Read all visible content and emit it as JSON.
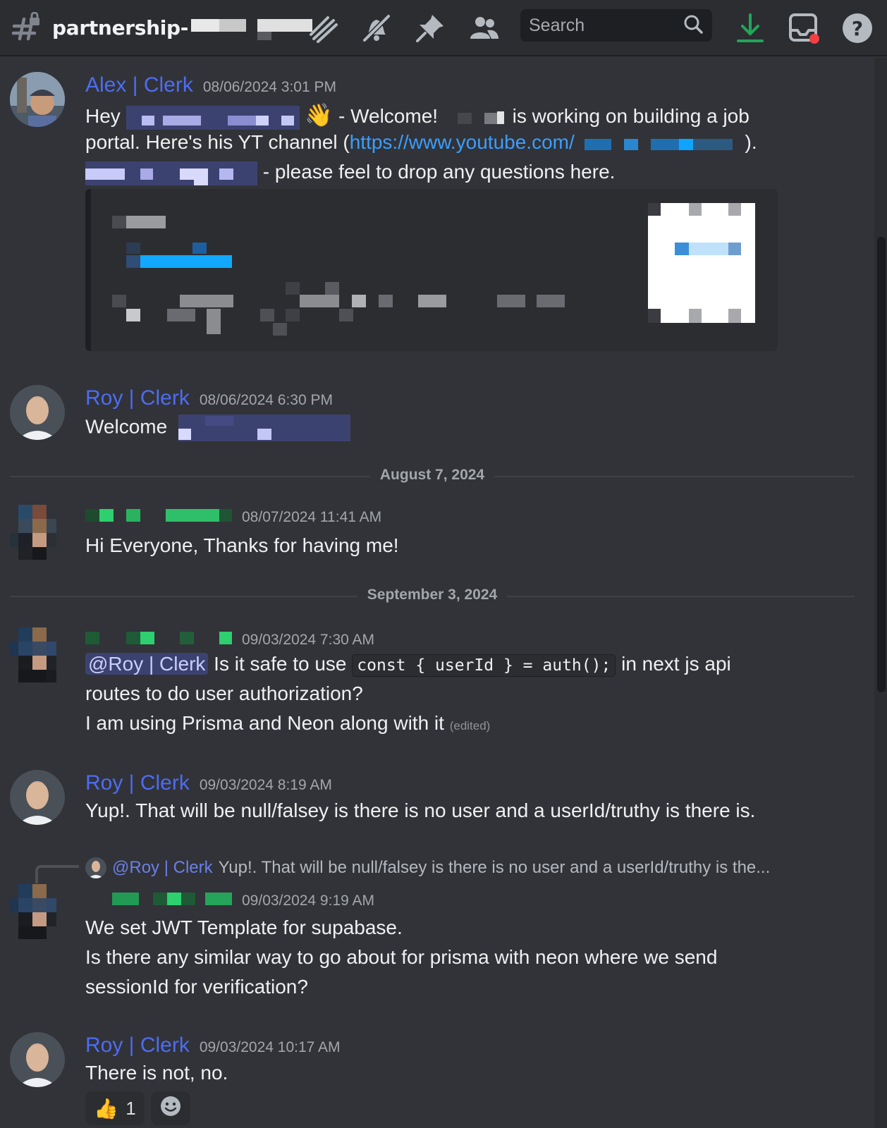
{
  "header": {
    "channel_name": "partnership-",
    "search_placeholder": "Search",
    "icons": [
      "hash-lock-icon",
      "threads-icon",
      "mute-icon",
      "pin-icon",
      "members-icon",
      "search-icon",
      "download-icon",
      "inbox-icon",
      "help-icon"
    ]
  },
  "messages": [
    {
      "author": "Alex | Clerk",
      "timestamp": "08/06/2024 3:01 PM",
      "line1_prefix": "Hey",
      "line1_wave": "👋",
      "line1_text": "- Welcome!",
      "line1_suffix": "is working on building a job",
      "line2_text": "portal. Here's his YT channel (",
      "line2_link": "https://www.youtube.com/",
      "line2_close": ").",
      "line3_text": "- please feel to drop any questions here."
    },
    {
      "author": "Roy | Clerk",
      "timestamp": "08/06/2024 6:30 PM",
      "text": "Welcome"
    },
    {
      "date_divider": "August 7, 2024",
      "timestamp": "08/07/2024 11:41 AM",
      "text": "Hi Everyone, Thanks for having me!"
    },
    {
      "date_divider": "September 3, 2024",
      "timestamp": "09/03/2024 7:30 AM",
      "mention": "@Roy | Clerk",
      "text_a": "Is it safe to use",
      "code": "const { userId } = auth();",
      "text_b": "in next js api",
      "line2": "routes to do user authorization?",
      "line3": "I am using Prisma and Neon along with it",
      "edited": "(edited)"
    },
    {
      "author": "Roy | Clerk",
      "timestamp": "09/03/2024 8:19 AM",
      "text": "Yup!. That will be null/falsey is there is no user and a userId/truthy is there is."
    },
    {
      "reply_mention": "@Roy | Clerk",
      "reply_preview": "Yup!. That will be null/falsey is there is no user and a userId/truthy is the...",
      "timestamp": "09/03/2024 9:19 AM",
      "line1": "We set JWT Template for supabase.",
      "line2": "Is there any similar way to go about for prisma with neon where we send",
      "line3": "sessionId for verification?"
    },
    {
      "author": "Roy | Clerk",
      "timestamp": "09/03/2024 10:17 AM",
      "text": "There is not, no.",
      "reaction_emoji": "👍",
      "reaction_count": "1"
    }
  ]
}
